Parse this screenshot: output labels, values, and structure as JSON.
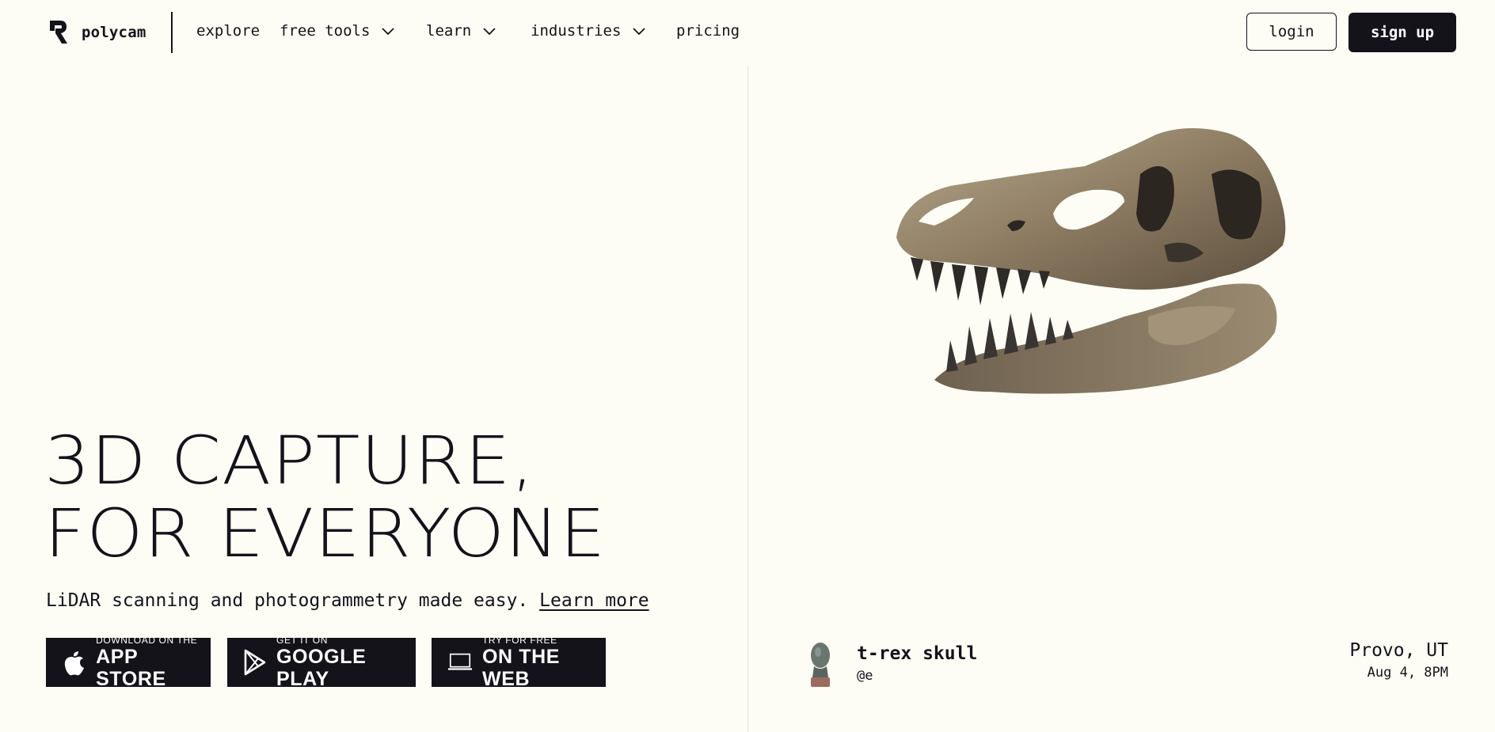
{
  "brand": {
    "name": "polycam"
  },
  "nav": {
    "items": [
      {
        "label": "explore",
        "dropdown": false
      },
      {
        "label": "free tools",
        "dropdown": true
      },
      {
        "label": "learn",
        "dropdown": true
      },
      {
        "label": "industries",
        "dropdown": true
      },
      {
        "label": "pricing",
        "dropdown": false
      }
    ],
    "login_label": "login",
    "signup_label": "sign up"
  },
  "hero": {
    "title_line1": "3D CAPTURE,",
    "title_line2": "FOR EVERYONE",
    "subtitle": "LiDAR scanning and photogrammetry made easy.",
    "learn_more": "Learn more",
    "stores": [
      {
        "small": "DOWNLOAD ON THE",
        "big": "APP STORE",
        "icon": "apple-icon"
      },
      {
        "small": "GET IT ON",
        "big": "GOOGLE PLAY",
        "icon": "google-play-icon"
      },
      {
        "small": "TRY FOR FREE",
        "big": "ON THE WEB",
        "icon": "laptop-icon"
      }
    ]
  },
  "featured": {
    "title": "t-rex skull",
    "user": "@e",
    "location": "Provo, UT",
    "date": "Aug 4, 8PM"
  },
  "colors": {
    "background": "#fdfdf6",
    "ink": "#14131a",
    "divider": "#e5e2cc"
  }
}
